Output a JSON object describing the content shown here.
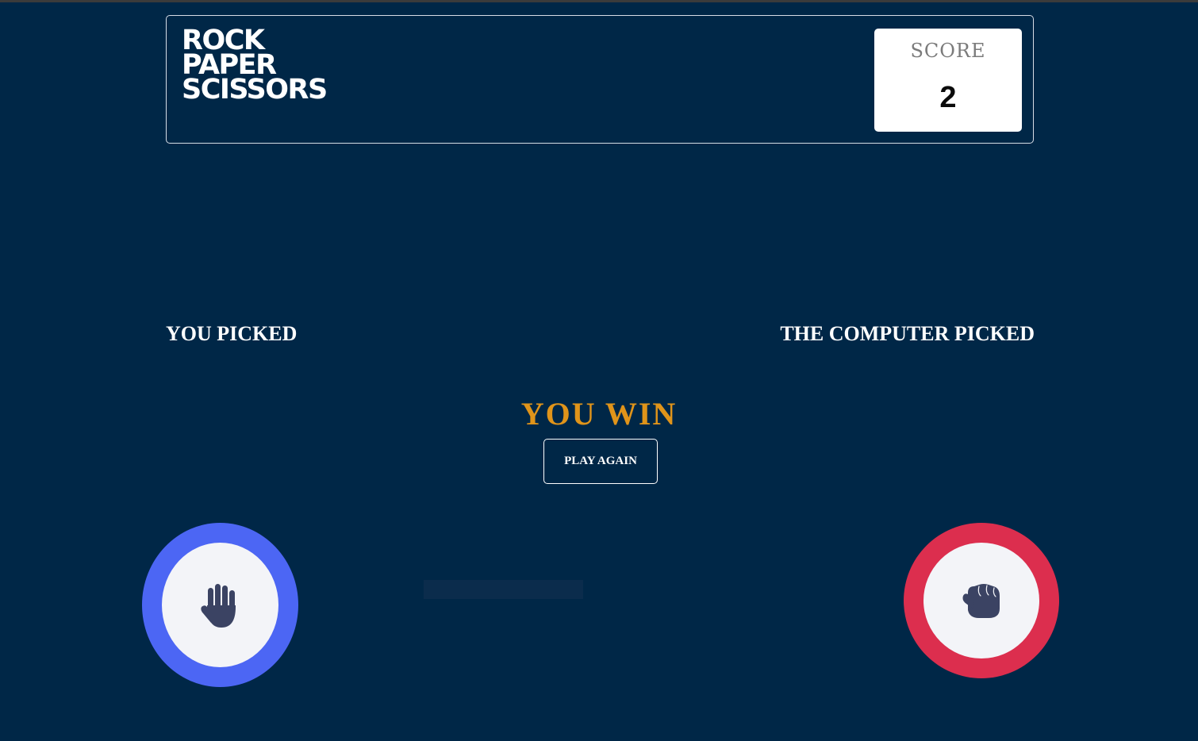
{
  "header": {
    "title_lines": [
      "ROCK",
      "PAPER",
      "SCISSORS"
    ],
    "score_label": "SCORE",
    "score_value": "2"
  },
  "picks": {
    "you_label": "YOU PICKED",
    "computer_label": "THE COMPUTER PICKED",
    "you_choice": {
      "name": "paper",
      "icon": "paper-hand-icon",
      "ring_color": "#4c66f4"
    },
    "computer_choice": {
      "name": "rock",
      "icon": "rock-fist-icon",
      "ring_color": "#dc2e4e"
    }
  },
  "result": {
    "text": "YOU WIN",
    "play_again_label": "PLAY AGAIN"
  },
  "colors": {
    "background": "#002747",
    "result_text": "#e0941a",
    "icon_fill": "#3b4363",
    "token_face": "#f3f4f8"
  }
}
